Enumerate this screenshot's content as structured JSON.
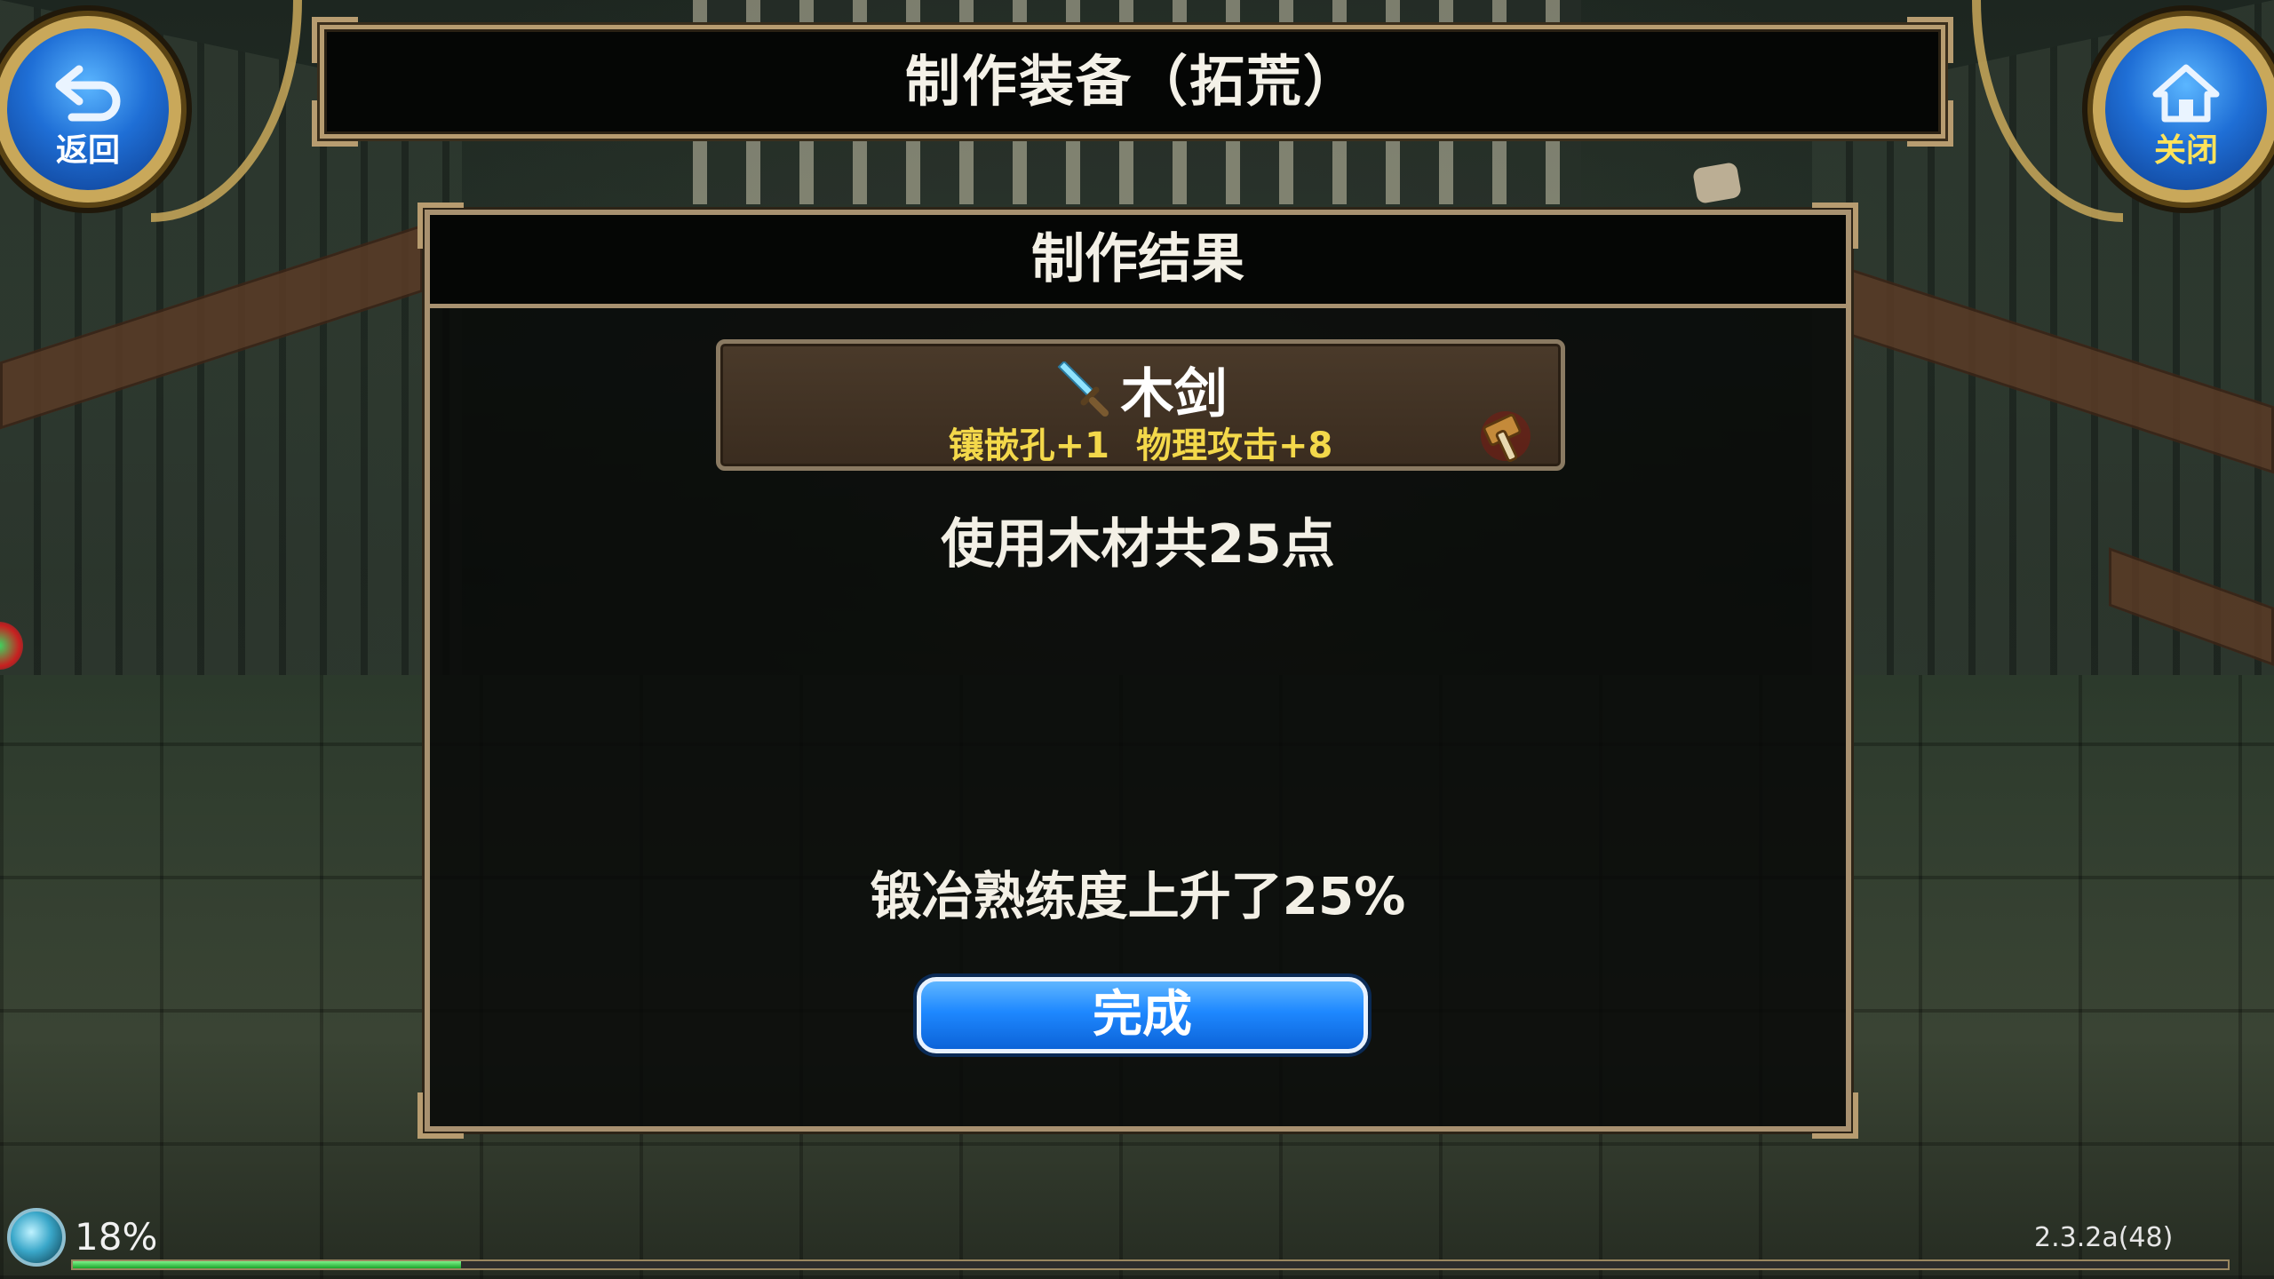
{
  "header": {
    "title": "制作装备（拓荒）",
    "back_label": "返回",
    "close_label": "关闭"
  },
  "panel": {
    "title": "制作结果",
    "item": {
      "name": "木剑",
      "stats": [
        "镶嵌孔+1",
        "物理攻击+8"
      ]
    },
    "usage_text": "使用木材共25点",
    "skill_text": "锻冶熟练度上升了25%",
    "done_label": "完成"
  },
  "hud": {
    "exp_percent": "18%",
    "exp_value": 0.18,
    "version": "2.3.2a(48)"
  },
  "icons": {
    "back": "back-arrow-icon",
    "close": "home-icon",
    "item": "sword-icon",
    "craft": "hammer-icon"
  },
  "colors": {
    "stat_yellow": "#f3d84a",
    "button_blue": "#1e88ff",
    "frame_gold": "#b79c70"
  }
}
